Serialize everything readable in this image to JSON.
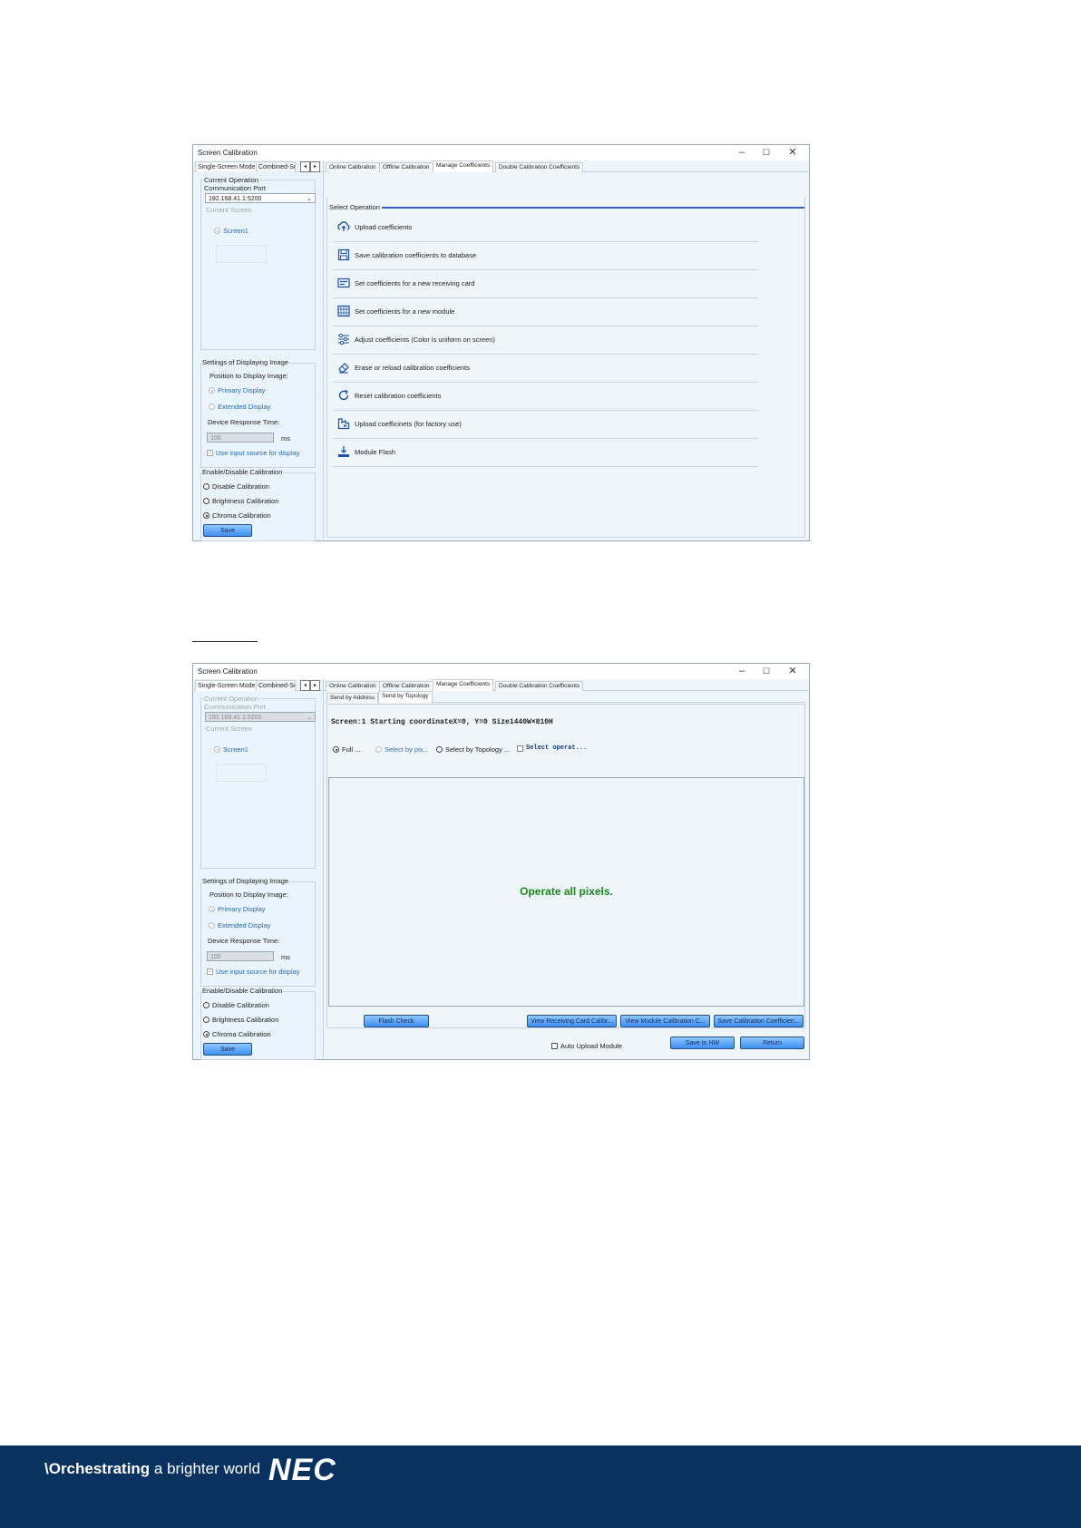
{
  "window": {
    "title": "Screen Calibration",
    "controls": [
      "–",
      "☐",
      "✕"
    ]
  },
  "left": {
    "tabs": [
      "Single-Screen Mode",
      "Combined-Sc"
    ],
    "arrows": [
      "◂",
      "▸"
    ],
    "current_operation_label": "Current Operation",
    "comm_port_label": "Communication Port",
    "comm_port_value": "192.168.41.1:5200",
    "current_screen_label": "Current Screen",
    "screen_item": "Screen1",
    "display_group_label": "Settings of Displaying Image",
    "position_label": "Position to Display Image:",
    "primary_display": "Primary Display",
    "extended_display": "Extended Display",
    "response_label": "Device Response Time:",
    "response_value": "100",
    "response_unit": "ms",
    "input_source": "Use input source for display",
    "calib_group_label": "Enable/Disable Calibration",
    "disable": "Disable Calibration",
    "brightness": "Brightness Calibration",
    "chroma": "Chroma Calibration",
    "save": "Save"
  },
  "right_tabs": [
    "Online Calibration",
    "Offline Calibration",
    "Manage Coefficients",
    "Double Calibration Coefficients"
  ],
  "panel1": {
    "section_label": "Select Operation",
    "operations": [
      {
        "icon": "upload-cloud-icon",
        "label": "Upload coefficients"
      },
      {
        "icon": "floppy-disk-icon",
        "label": "Save calibration coefficients to database"
      },
      {
        "icon": "receiving-card-icon",
        "label": "Set coefficients for a new receiving card"
      },
      {
        "icon": "module-grid-icon",
        "label": "Set coefficients for a new module"
      },
      {
        "icon": "sliders-icon",
        "label": "Adjust coefficients (Color is uniform on screen)"
      },
      {
        "icon": "eraser-icon",
        "label": "Erase or reload calibration coefficients"
      },
      {
        "icon": "reset-icon",
        "label": "Reset calibration coefficients"
      },
      {
        "icon": "factory-icon",
        "label": "Upload coefficinets (for factory use)"
      },
      {
        "icon": "download-tray-icon",
        "label": "Module Flash"
      }
    ]
  },
  "panel2": {
    "subtabs": [
      "Send by Address",
      "Send by Topology"
    ],
    "screen_info": "Screen:1  Starting coordinateX=0, Y=0   Size1440W×810H",
    "modes": [
      "Full ...",
      "Select by pix...",
      "Select by Topology ..."
    ],
    "select_operat": "Select operat...",
    "message": "Operate all pixels.",
    "buttons": {
      "flash_check": "Flash Check",
      "view_receiving": "View Receiving Card Calibr...",
      "view_module": "View Module Calibration C...",
      "save_coeff": "Save Calibration Coefficien...",
      "auto_upload": "Auto Upload Module",
      "save_hw": "Save to HW",
      "return": "Return"
    }
  },
  "footer": {
    "tagline_bold": "\\Orchestrating",
    "tagline_rest": " a brighter world",
    "logo": "NEC"
  }
}
